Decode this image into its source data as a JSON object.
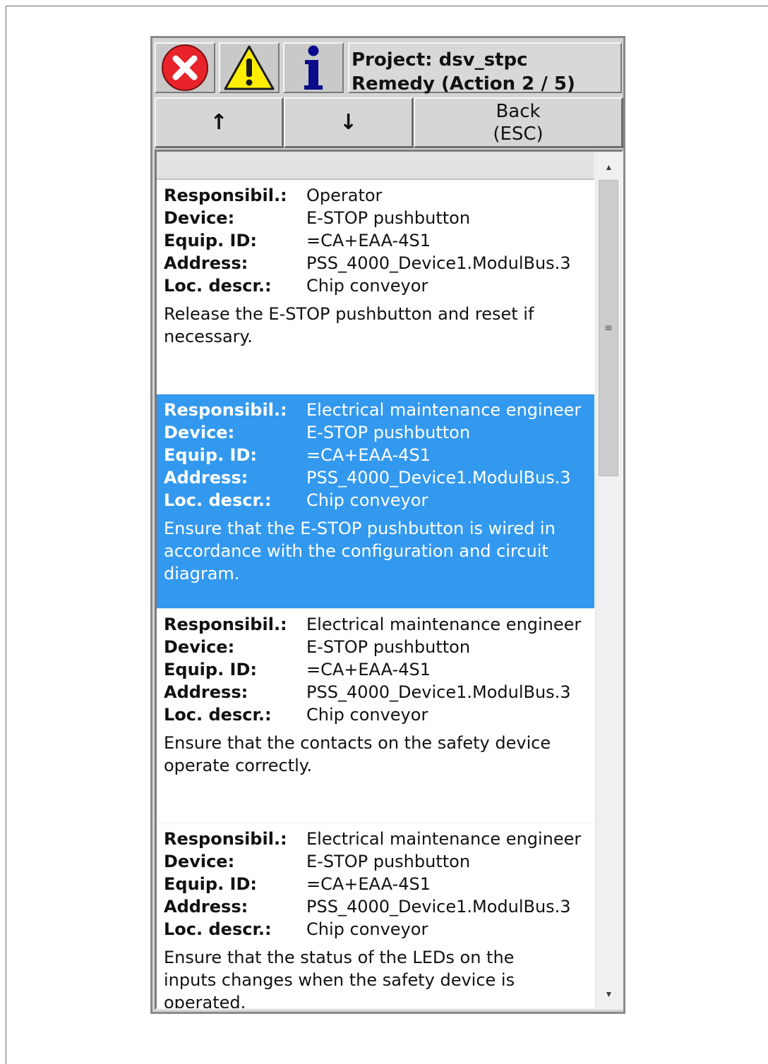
{
  "header": {
    "icons": [
      "error-icon",
      "warning-icon",
      "info-icon"
    ],
    "title_line1": "Project: dsv_stpc",
    "title_line2": "Remedy (Action 2 / 5)"
  },
  "toolbar": {
    "up_label": "↑",
    "down_label": "↓",
    "back_label_line1": "Back",
    "back_label_line2": "(ESC)"
  },
  "labels": {
    "responsibility": "Responsibil.:",
    "device": "Device:",
    "equip_id": "Equip. ID:",
    "address": "Address:",
    "location": "Loc. descr.:"
  },
  "entries": [
    {
      "responsibility": "Operator",
      "device": "E-STOP pushbutton",
      "equip_id": "=CA+EAA-4S1",
      "address": "PSS_4000_Device1.ModulBus.3",
      "location": "Chip conveyor",
      "remedy": "Release the E-STOP pushbutton and reset if necessary.",
      "selected": false
    },
    {
      "responsibility": "Electrical maintenance engineer",
      "device": "E-STOP pushbutton",
      "equip_id": "=CA+EAA-4S1",
      "address": "PSS_4000_Device1.ModulBus.3",
      "location": "Chip conveyor",
      "remedy": "Ensure that the E-STOP pushbutton is wired in accordance with the configuration and circuit diagram.",
      "selected": true
    },
    {
      "responsibility": "Electrical maintenance engineer",
      "device": "E-STOP pushbutton",
      "equip_id": "=CA+EAA-4S1",
      "address": "PSS_4000_Device1.ModulBus.3",
      "location": "Chip conveyor",
      "remedy": "Ensure that the contacts on the safety device operate correctly.",
      "selected": false
    },
    {
      "responsibility": "Electrical maintenance engineer",
      "device": "E-STOP pushbutton",
      "equip_id": "=CA+EAA-4S1",
      "address": "PSS_4000_Device1.ModulBus.3",
      "location": "Chip conveyor",
      "remedy": "Ensure that the status of the LEDs on the inputs changes when the safety device is operated.",
      "selected": false
    }
  ],
  "colors": {
    "selection": "#3399ee",
    "error_icon": "#e8242a",
    "warning_icon": "#ffee00",
    "info_icon": "#0a0a8a"
  }
}
